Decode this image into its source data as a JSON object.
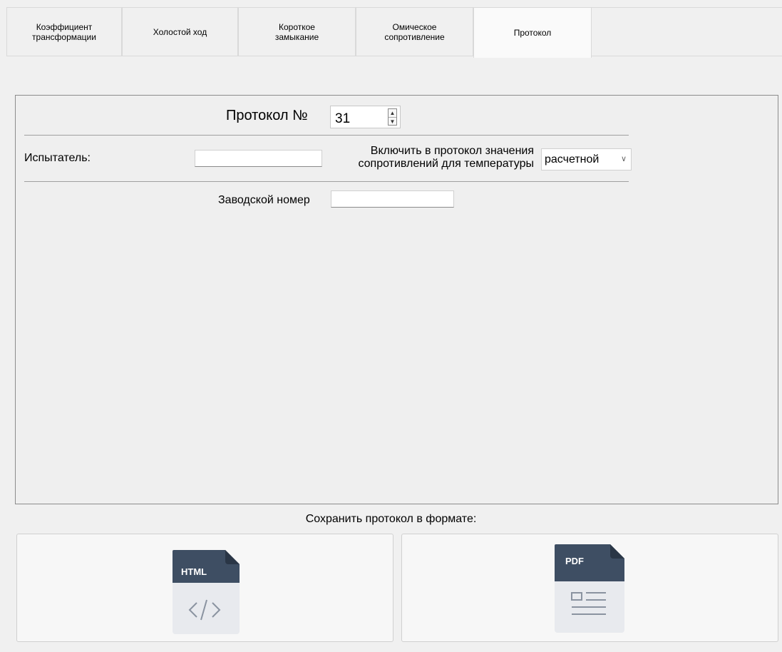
{
  "tabs": [
    {
      "label": "Коэффициент\nтрансформации"
    },
    {
      "label": "Холостой ход"
    },
    {
      "label": "Короткое\nзамыкание"
    },
    {
      "label": "Омическое\nсопротивление"
    },
    {
      "label": "Протокол"
    }
  ],
  "protocol": {
    "title": "Протокол №",
    "number": "31",
    "tester_label": "Испытатель:",
    "tester_value": "",
    "include_label": "Включить в протокол значения сопротивлений для температуры",
    "include_select_value": "расчетной",
    "serial_label": "Заводской номер",
    "serial_value": ""
  },
  "save": {
    "caption": "Сохранить протокол в формате:",
    "html_label": "HTML",
    "pdf_label": "PDF"
  },
  "colors": {
    "file_header": "#3e4e63",
    "file_body": "#e8eaee",
    "accent": "#2f3e52"
  },
  "icons": [
    "html-file-icon",
    "pdf-file-icon",
    "chevron-down-icon",
    "spin-up-icon",
    "spin-down-icon"
  ]
}
